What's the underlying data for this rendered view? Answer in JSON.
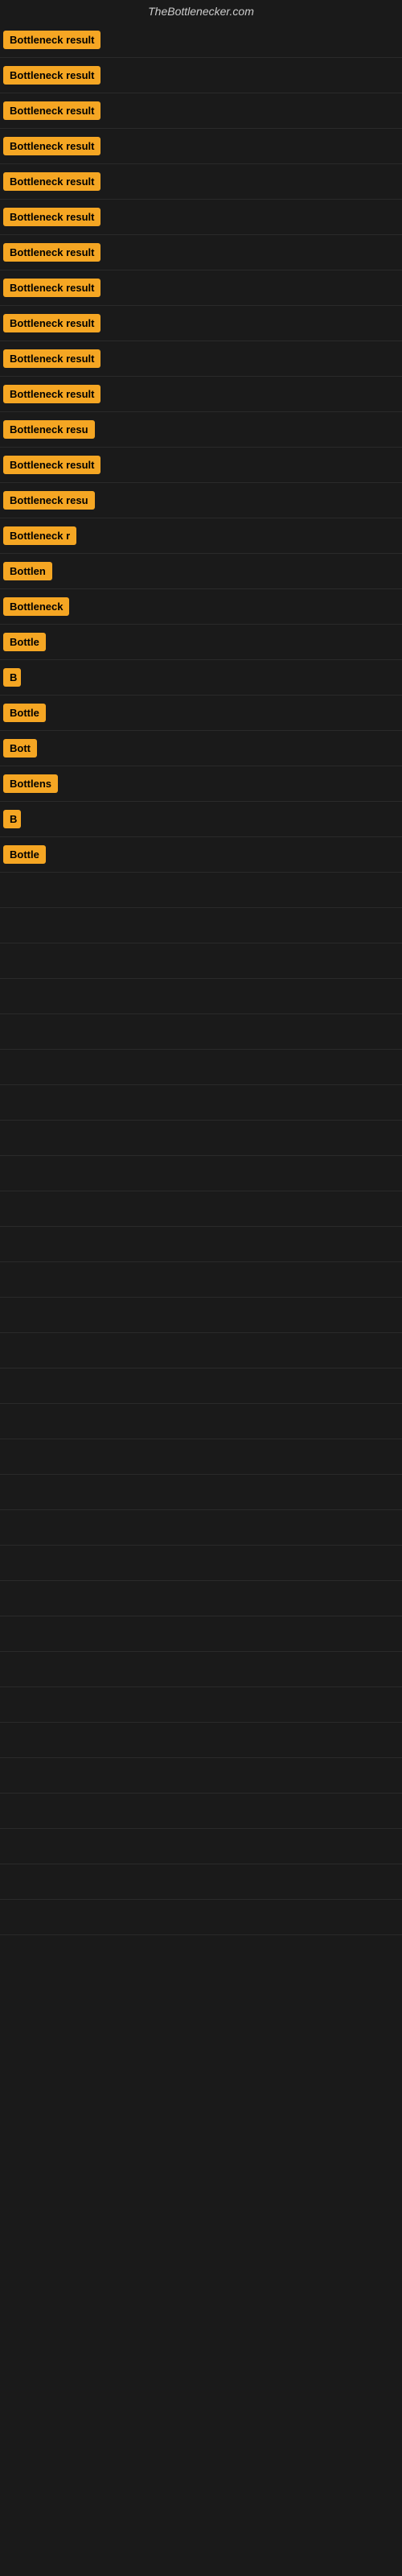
{
  "site": {
    "title": "TheBottlenecker.com"
  },
  "rows": [
    {
      "id": 1,
      "badge_text": "Bottleneck result",
      "truncated": false
    },
    {
      "id": 2,
      "badge_text": "Bottleneck result",
      "truncated": false
    },
    {
      "id": 3,
      "badge_text": "Bottleneck result",
      "truncated": false
    },
    {
      "id": 4,
      "badge_text": "Bottleneck result",
      "truncated": false
    },
    {
      "id": 5,
      "badge_text": "Bottleneck result",
      "truncated": false
    },
    {
      "id": 6,
      "badge_text": "Bottleneck result",
      "truncated": false
    },
    {
      "id": 7,
      "badge_text": "Bottleneck result",
      "truncated": false
    },
    {
      "id": 8,
      "badge_text": "Bottleneck result",
      "truncated": false
    },
    {
      "id": 9,
      "badge_text": "Bottleneck result",
      "truncated": false
    },
    {
      "id": 10,
      "badge_text": "Bottleneck result",
      "truncated": false
    },
    {
      "id": 11,
      "badge_text": "Bottleneck result",
      "truncated": false
    },
    {
      "id": 12,
      "badge_text": "Bottleneck resu",
      "truncated": true
    },
    {
      "id": 13,
      "badge_text": "Bottleneck result",
      "truncated": true,
      "max_width": 140
    },
    {
      "id": 14,
      "badge_text": "Bottleneck resu",
      "truncated": true,
      "max_width": 130
    },
    {
      "id": 15,
      "badge_text": "Bottleneck r",
      "truncated": true,
      "max_width": 110
    },
    {
      "id": 16,
      "badge_text": "Bottlen",
      "truncated": true,
      "max_width": 80
    },
    {
      "id": 17,
      "badge_text": "Bottleneck",
      "truncated": true,
      "max_width": 90
    },
    {
      "id": 18,
      "badge_text": "Bottle",
      "truncated": true,
      "max_width": 65
    },
    {
      "id": 19,
      "badge_text": "B",
      "truncated": true,
      "max_width": 22
    },
    {
      "id": 20,
      "badge_text": "Bottle",
      "truncated": true,
      "max_width": 65
    },
    {
      "id": 21,
      "badge_text": "Bott",
      "truncated": true,
      "max_width": 50
    },
    {
      "id": 22,
      "badge_text": "Bottlens",
      "truncated": true,
      "max_width": 78
    },
    {
      "id": 23,
      "badge_text": "B",
      "truncated": true,
      "max_width": 22
    },
    {
      "id": 24,
      "badge_text": "Bottle",
      "truncated": true,
      "max_width": 60
    }
  ],
  "empty_rows": 30
}
